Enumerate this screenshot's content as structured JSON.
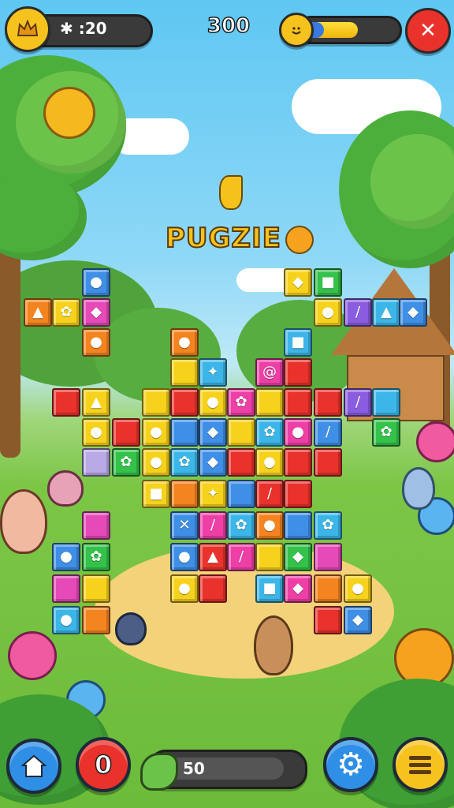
{
  "hud": {
    "timer_label": "✱ :20",
    "score": "300",
    "progress_fraction": 0.6,
    "close_icon": "close-icon",
    "crown_icon": "crown-icon",
    "smiley_icon": "smiley-icon"
  },
  "title": {
    "logo_text": "PUGZIE"
  },
  "board": {
    "tile_colors": {
      "red": "#e8322b",
      "yellow": "#f7d21c",
      "blue": "#3f8fe6",
      "lightblue": "#3cb6e8",
      "green": "#34c24a",
      "pink": "#ee3fa6",
      "magenta": "#e54ab8",
      "orange": "#f4841f",
      "purple": "#8a5de0",
      "lilac": "#b9a9e6"
    }
  },
  "bottom_bar": {
    "home_icon": "home-icon",
    "counter_value": "0",
    "progress_value": "50",
    "settings_icon": "gear-icon",
    "menu_icon": "menu-icon"
  }
}
